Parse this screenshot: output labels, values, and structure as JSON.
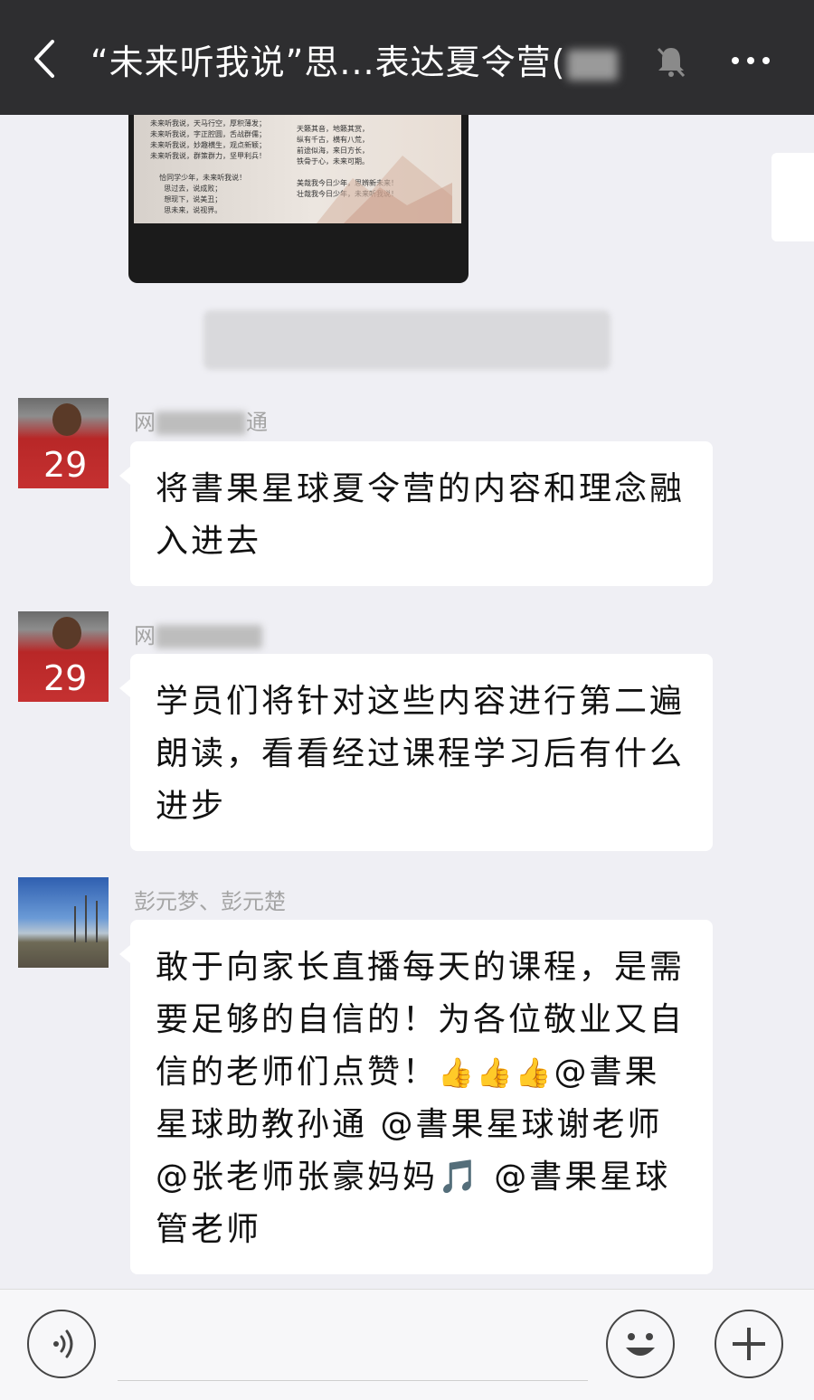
{
  "header": {
    "title": "“未来听我说”思...表达夏令营(",
    "title_suffix": "",
    "icons": {
      "back": "chevron-left-icon",
      "mute": "bell-mute-icon",
      "more": "more-dots-icon"
    }
  },
  "chat": {
    "photo_message": {
      "poem_left": "未来听我说，天马行空，厚积薄发；\n未来听我说，字正腔圆，舌战群儒；\n未来听我说，妙趣横生，观点新颖；\n未来听我说，群策群力，坚甲利兵！\n\n    恰同学少年，未来听我说！\n      思过去，说成败；\n      想现下，说美丑；\n      思未来，说视界。",
      "poem_right": "天籁其音，地籁其赏，\n纵有千古，横有八荒，\n前途似海，来日方长，\n铁骨于心，未来可期。\n\n美哉我今日少年，思辨新未来！\n壮哉我今日少年，未来听我说！"
    },
    "system_note": "",
    "messages": [
      {
        "sender_prefix": "网",
        "sender_suffix": "通",
        "text": "将書果星球夏令营的内容和理念融入进去"
      },
      {
        "sender_prefix": "网",
        "sender_suffix": "",
        "text": "学员们将针对这些内容进行第二遍朗读，看看经过课程学习后有什么进步"
      },
      {
        "sender": "彭元梦、彭元楚",
        "text_before": "敢于向家长直播每天的课程，是需要足够的自信的！为各位敬业又自信的老师们点赞！",
        "thumbs": "👍👍👍",
        "text_middle": "@書果星球助教孙通 @書果星球谢老师 @张老师张豪妈妈",
        "music": "🎵",
        "text_after": " @書果星球管老师"
      }
    ]
  },
  "input_bar": {
    "icons": {
      "voice": "voice-icon",
      "emoji": "emoji-icon",
      "plus": "plus-icon"
    }
  },
  "colors": {
    "header_bg": "#2e2e30",
    "chat_bg": "#efeff4",
    "bubble_bg": "#ffffff"
  }
}
